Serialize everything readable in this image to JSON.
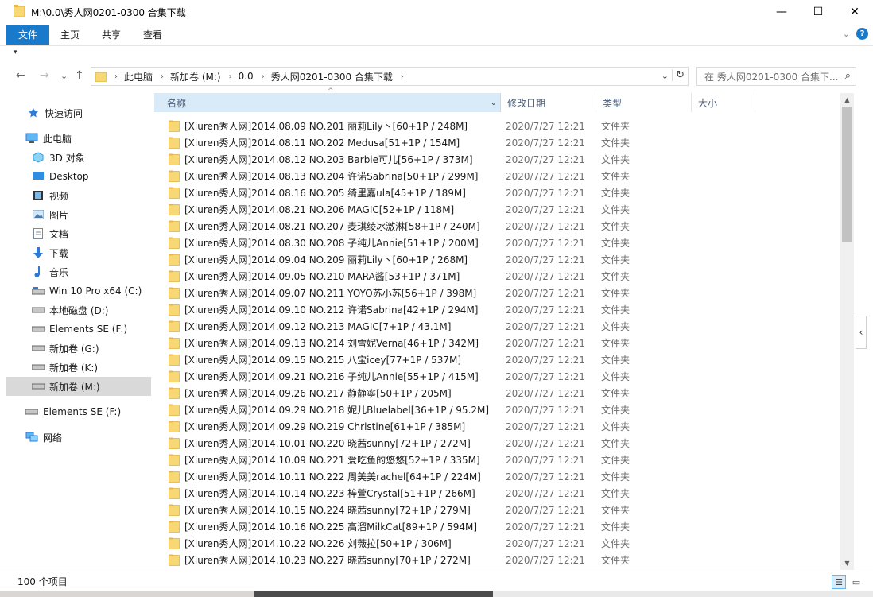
{
  "window": {
    "title": "M:\\0.0\\秀人网0201-0300 合集下载",
    "minimize": "—",
    "maximize": "☐",
    "close": "✕"
  },
  "ribbon": {
    "tabs": [
      "文件",
      "主页",
      "共享",
      "查看"
    ],
    "help": "?",
    "expand": "⌄"
  },
  "qat": {
    "dropdown": "▾"
  },
  "nav": {
    "back": "←",
    "forward": "→",
    "recent": "⌄",
    "up": "↑",
    "crumbs": [
      "此电脑",
      "新加卷 (M:)",
      "0.0",
      "秀人网0201-0300 合集下载"
    ],
    "search_placeholder": "在 秀人网0201-0300 合集下...",
    "dropdown": "⌄",
    "refresh": "↻",
    "search_icon": "⌕"
  },
  "sidebar": {
    "items": [
      {
        "label": "快速访问",
        "icon": "star-icon"
      },
      {
        "label": "此电脑",
        "icon": "computer-icon"
      },
      {
        "label": "3D 对象",
        "icon": "cube-icon"
      },
      {
        "label": "Desktop",
        "icon": "desktop-icon"
      },
      {
        "label": "视频",
        "icon": "video-icon"
      },
      {
        "label": "图片",
        "icon": "picture-icon"
      },
      {
        "label": "文档",
        "icon": "document-icon"
      },
      {
        "label": "下载",
        "icon": "download-icon"
      },
      {
        "label": "音乐",
        "icon": "music-icon"
      },
      {
        "label": "Win 10 Pro x64 (C:)",
        "icon": "drive-icon"
      },
      {
        "label": "本地磁盘 (D:)",
        "icon": "drive-icon"
      },
      {
        "label": "Elements SE (F:)",
        "icon": "drive-icon"
      },
      {
        "label": "新加卷 (G:)",
        "icon": "drive-icon"
      },
      {
        "label": "新加卷 (K:)",
        "icon": "drive-icon"
      },
      {
        "label": "新加卷 (M:)",
        "icon": "drive-icon"
      },
      {
        "label": "Elements SE (F:)",
        "icon": "drive-icon"
      },
      {
        "label": "网络",
        "icon": "network-icon"
      }
    ]
  },
  "columns": {
    "name": "名称",
    "date": "修改日期",
    "type": "类型",
    "size": "大小",
    "sort": "^",
    "dropdown": "⌄"
  },
  "files": [
    {
      "name": "[Xiuren秀人网]2014.08.09 NO.201 丽莉Lily丶[60+1P / 248M]",
      "date": "2020/7/27 12:21",
      "type": "文件夹"
    },
    {
      "name": "[Xiuren秀人网]2014.08.11 NO.202 Medusa[51+1P / 154M]",
      "date": "2020/7/27 12:21",
      "type": "文件夹"
    },
    {
      "name": "[Xiuren秀人网]2014.08.12 NO.203 Barbie可儿[56+1P / 373M]",
      "date": "2020/7/27 12:21",
      "type": "文件夹"
    },
    {
      "name": "[Xiuren秀人网]2014.08.13 NO.204 许诺Sabrina[50+1P / 299M]",
      "date": "2020/7/27 12:21",
      "type": "文件夹"
    },
    {
      "name": "[Xiuren秀人网]2014.08.16 NO.205 绮里嘉ula[45+1P / 189M]",
      "date": "2020/7/27 12:21",
      "type": "文件夹"
    },
    {
      "name": "[Xiuren秀人网]2014.08.21 NO.206 MAGIC[52+1P / 118M]",
      "date": "2020/7/27 12:21",
      "type": "文件夹"
    },
    {
      "name": "[Xiuren秀人网]2014.08.21 NO.207 麦琪绫冰激淋[58+1P / 240M]",
      "date": "2020/7/27 12:21",
      "type": "文件夹"
    },
    {
      "name": "[Xiuren秀人网]2014.08.30 NO.208 子纯儿Annie[51+1P / 200M]",
      "date": "2020/7/27 12:21",
      "type": "文件夹"
    },
    {
      "name": "[Xiuren秀人网]2014.09.04 NO.209 丽莉Lily丶[60+1P / 268M]",
      "date": "2020/7/27 12:21",
      "type": "文件夹"
    },
    {
      "name": "[Xiuren秀人网]2014.09.05 NO.210 MARA酱[53+1P / 371M]",
      "date": "2020/7/27 12:21",
      "type": "文件夹"
    },
    {
      "name": "[Xiuren秀人网]2014.09.07 NO.211 YOYO苏小苏[56+1P / 398M]",
      "date": "2020/7/27 12:21",
      "type": "文件夹"
    },
    {
      "name": "[Xiuren秀人网]2014.09.10 NO.212 许诺Sabrina[42+1P / 294M]",
      "date": "2020/7/27 12:21",
      "type": "文件夹"
    },
    {
      "name": "[Xiuren秀人网]2014.09.12 NO.213 MAGIC[7+1P / 43.1M]",
      "date": "2020/7/27 12:21",
      "type": "文件夹"
    },
    {
      "name": "[Xiuren秀人网]2014.09.13 NO.214 刘雪妮Verna[46+1P / 342M]",
      "date": "2020/7/27 12:21",
      "type": "文件夹"
    },
    {
      "name": "[Xiuren秀人网]2014.09.15 NO.215 八宝icey[77+1P / 537M]",
      "date": "2020/7/27 12:21",
      "type": "文件夹"
    },
    {
      "name": "[Xiuren秀人网]2014.09.21 NO.216 子纯儿Annie[55+1P / 415M]",
      "date": "2020/7/27 12:21",
      "type": "文件夹"
    },
    {
      "name": "[Xiuren秀人网]2014.09.26 NO.217 静静寧[50+1P / 205M]",
      "date": "2020/7/27 12:21",
      "type": "文件夹"
    },
    {
      "name": "[Xiuren秀人网]2014.09.29 NO.218 妮儿Bluelabel[36+1P / 95.2M]",
      "date": "2020/7/27 12:21",
      "type": "文件夹"
    },
    {
      "name": "[Xiuren秀人网]2014.09.29 NO.219 Christine[61+1P / 385M]",
      "date": "2020/7/27 12:21",
      "type": "文件夹"
    },
    {
      "name": "[Xiuren秀人网]2014.10.01 NO.220 晓茜sunny[72+1P / 272M]",
      "date": "2020/7/27 12:21",
      "type": "文件夹"
    },
    {
      "name": "[Xiuren秀人网]2014.10.09 NO.221 爱吃鱼的悠悠[52+1P / 335M]",
      "date": "2020/7/27 12:21",
      "type": "文件夹"
    },
    {
      "name": "[Xiuren秀人网]2014.10.11 NO.222 周美美rachel[64+1P / 224M]",
      "date": "2020/7/27 12:21",
      "type": "文件夹"
    },
    {
      "name": "[Xiuren秀人网]2014.10.14 NO.223 梓萱Crystal[51+1P / 266M]",
      "date": "2020/7/27 12:21",
      "type": "文件夹"
    },
    {
      "name": "[Xiuren秀人网]2014.10.15 NO.224 晓茜sunny[72+1P / 279M]",
      "date": "2020/7/27 12:21",
      "type": "文件夹"
    },
    {
      "name": "[Xiuren秀人网]2014.10.16 NO.225 高溜MilkCat[89+1P / 594M]",
      "date": "2020/7/27 12:21",
      "type": "文件夹"
    },
    {
      "name": "[Xiuren秀人网]2014.10.22 NO.226 刘薇拉[50+1P / 306M]",
      "date": "2020/7/27 12:21",
      "type": "文件夹"
    },
    {
      "name": "[Xiuren秀人网]2014.10.23 NO.227 晓茜sunny[70+1P / 272M]",
      "date": "2020/7/27 12:21",
      "type": "文件夹"
    }
  ],
  "scrollbar": {
    "up": "▲",
    "down": "▼"
  },
  "pane_toggle": "‹",
  "status": {
    "count": "100 个项目",
    "details_view": "☰",
    "tiles_view": "▭"
  },
  "colors": {
    "accent": "#1979ca",
    "folder": "#f8d775",
    "selected": "#d9ebf9"
  }
}
